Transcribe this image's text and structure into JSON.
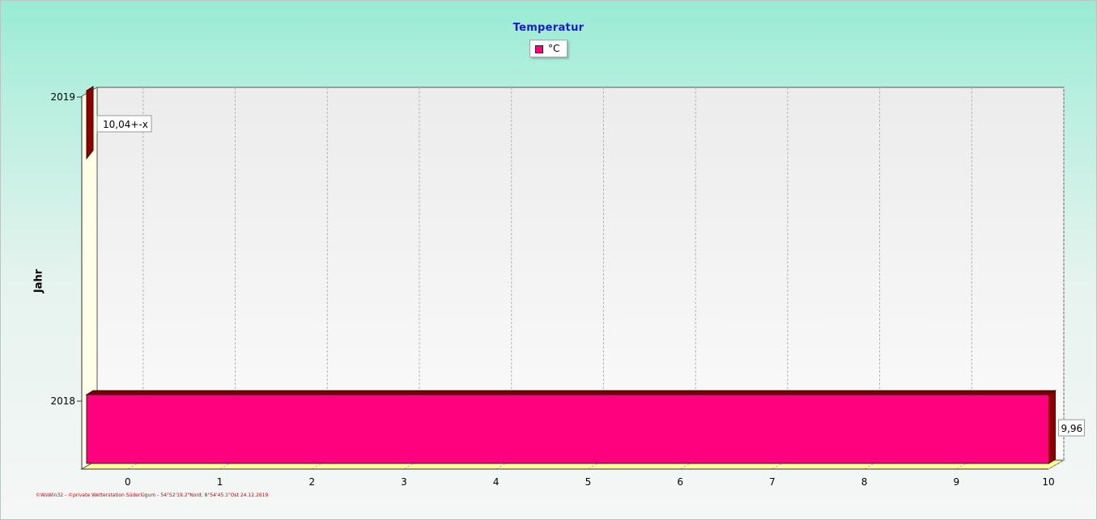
{
  "chart_data": {
    "type": "bar",
    "orientation": "horizontal",
    "title": "Temperatur",
    "ylabel": "Jahr",
    "xlabel": "",
    "categories": [
      "2018",
      "2019"
    ],
    "series": [
      {
        "name": "°C",
        "values": [
          9.96,
          10.04
        ],
        "data_labels": [
          "9,96",
          "10,04+-x"
        ]
      }
    ],
    "xlim": [
      -0.5,
      10
    ],
    "xticks": [
      "0",
      "1",
      "2",
      "3",
      "4",
      "5",
      "6",
      "7",
      "8",
      "9",
      "10"
    ],
    "grid": true,
    "legend_position": "top-center",
    "colors": {
      "bar": "#ff007f",
      "bar_side": "#8b0000",
      "bar_top": "#7a0000",
      "wall": "#ffffe8",
      "floor": "#ffff99",
      "title": "#1a1ad0",
      "footer": "#cc0000"
    }
  },
  "footer": "©WsWin32 - ©private Wetterstation Süderlügum - 54°52'19.2\"Nord; 8°54'45.1\"Ost 24.12.2019"
}
